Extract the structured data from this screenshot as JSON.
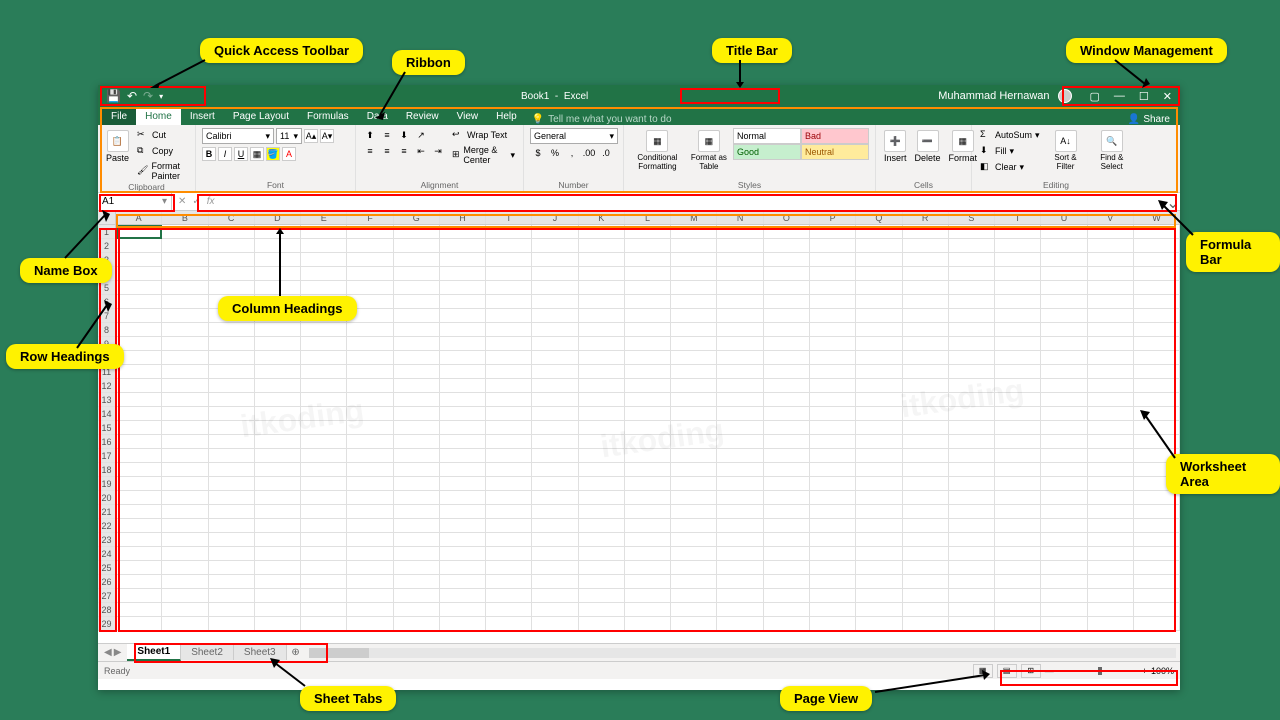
{
  "callouts": {
    "qat": "Quick Access Toolbar",
    "ribbon": "Ribbon",
    "titlebar": "Title Bar",
    "winmgmt": "Window Management",
    "namebox": "Name Box",
    "formulabar": "Formula Bar",
    "colheads": "Column Headings",
    "rowheads": "Row Headings",
    "worksheet": "Worksheet Area",
    "sheettabs": "Sheet Tabs",
    "pageview": "Page View"
  },
  "title": {
    "book": "Book1",
    "app": "Excel"
  },
  "user": "Muhammad Hernawan",
  "tabs": [
    "File",
    "Home",
    "Insert",
    "Page Layout",
    "Formulas",
    "Data",
    "Review",
    "View",
    "Help"
  ],
  "tellme": "Tell me what you want to do",
  "share": "Share",
  "clipboard": {
    "paste": "Paste",
    "cut": "Cut",
    "copy": "Copy",
    "fp": "Format Painter",
    "label": "Clipboard"
  },
  "font": {
    "name": "Calibri",
    "size": "11",
    "label": "Font"
  },
  "alignment": {
    "wrap": "Wrap Text",
    "merge": "Merge & Center",
    "label": "Alignment"
  },
  "number": {
    "format": "General",
    "label": "Number"
  },
  "styles": {
    "cf": "Conditional Formatting",
    "fat": "Format as Table",
    "normal": "Normal",
    "bad": "Bad",
    "good": "Good",
    "neutral": "Neutral",
    "label": "Styles"
  },
  "cells": {
    "insert": "Insert",
    "delete": "Delete",
    "format": "Format",
    "label": "Cells"
  },
  "editing": {
    "autosum": "AutoSum",
    "fill": "Fill",
    "clear": "Clear",
    "sort": "Sort & Filter",
    "find": "Find & Select",
    "label": "Editing"
  },
  "namebox_val": "A1",
  "fx": "fx",
  "cols": [
    "A",
    "B",
    "C",
    "D",
    "E",
    "F",
    "G",
    "H",
    "I",
    "J",
    "K",
    "L",
    "M",
    "N",
    "O",
    "P",
    "Q",
    "R",
    "S",
    "T",
    "U",
    "V",
    "W"
  ],
  "rows": [
    "1",
    "2",
    "3",
    "4",
    "5",
    "6",
    "7",
    "8",
    "9",
    "10",
    "11",
    "12",
    "13",
    "14",
    "15",
    "16",
    "17",
    "18",
    "19",
    "20",
    "21",
    "22",
    "23",
    "24",
    "25",
    "26",
    "27",
    "28",
    "29"
  ],
  "sheets": [
    "Sheet1",
    "Sheet2",
    "Sheet3"
  ],
  "status": "Ready",
  "zoom": "100%",
  "watermark": "itkoding"
}
